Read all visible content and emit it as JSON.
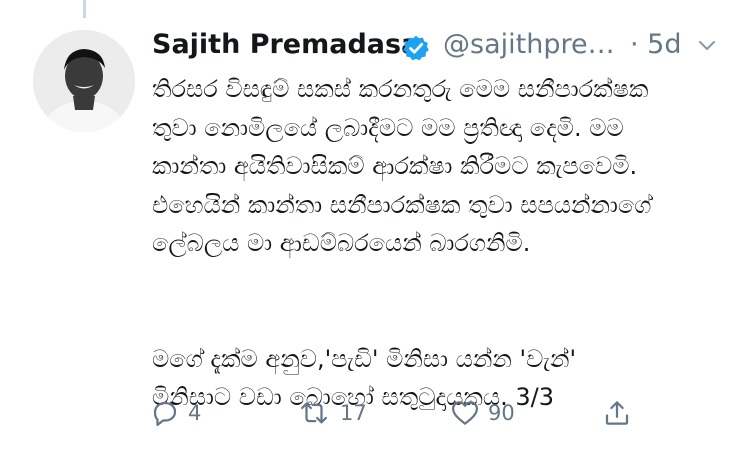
{
  "tweet": {
    "author_name": "Sajith Premadasa",
    "handle": "@sajithpre…",
    "time": "· 5d",
    "lines": [
      "තිරසර විසඳුම්  සකස් කරනතුරු මෙම සනීපාරක්ෂක",
      "තුවා නොමිලයේ ලබාදීමට මම ප්‍රතිඥා දෙමි. මම",
      "කාන්තා අයිතිවාසිකම් ආරක්ෂා කිරීමට කැපවෙමි.",
      "එහෙයින් කාන්තා සනීපාරක්ෂක තුවා සපයන්නාගේ",
      "ලේබලය මා ආඩම්බරයෙන් බාරගනිමි.",
      "මගේ දැක්ම අනුව,'පැඩි' මිනිසා යන්න  'වැන්'",
      "මිනිසාට වඩා බොහෝ සතුටුදායකය. 3/3"
    ]
  },
  "actions": {
    "reply_count": "4",
    "retweet_count": "17",
    "like_count": "90"
  },
  "icons": {
    "verified": "verified-badge-icon",
    "more": "chevron-down-icon",
    "reply": "reply-icon",
    "retweet": "retweet-icon",
    "like": "heart-icon",
    "share": "share-icon"
  },
  "colors": {
    "text": "#14171a",
    "secondary": "#657786",
    "verified": "#1da1f2",
    "thread_line": "#ccd6dd"
  }
}
